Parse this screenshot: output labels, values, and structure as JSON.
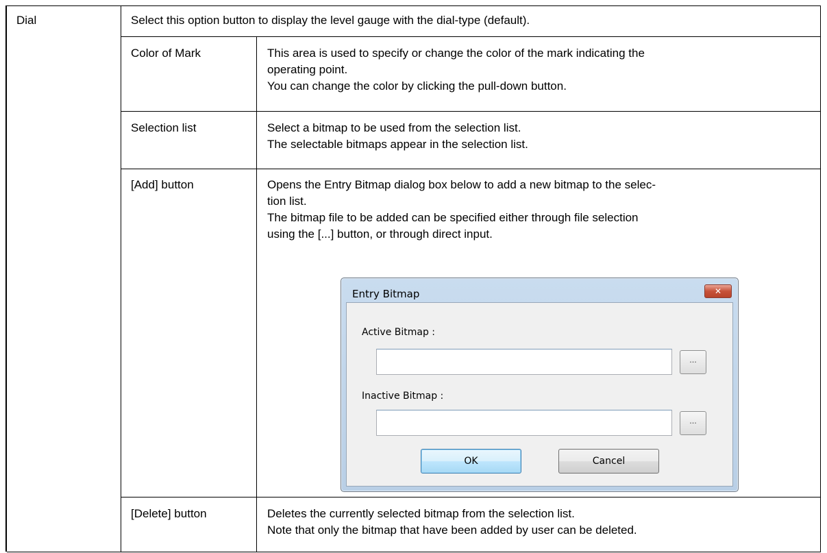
{
  "rows": {
    "dial": {
      "label": "Dial",
      "description": "Select this option button to display the level gauge with the dial-type (default)."
    },
    "color_of_mark": {
      "label": "Color of Mark",
      "lines": [
        "This area is used to specify or change the color of the mark indicating the",
        "operating point.",
        "You can change the color by clicking the pull-down button."
      ]
    },
    "selection_list": {
      "label": "Selection list",
      "lines": [
        "Select a bitmap to be used from the selection list.",
        "The selectable bitmaps appear in the selection list."
      ]
    },
    "add_button": {
      "label": "[Add] button",
      "lines": [
        "Opens the Entry Bitmap dialog box below to add a new bitmap to the selec-",
        "tion list.",
        "The bitmap file to be added can be specified either through file selection",
        "using the [...] button, or through direct input."
      ]
    },
    "delete_button": {
      "label": "[Delete] button",
      "lines": [
        "Deletes the currently selected bitmap from the selection list.",
        "Note that only the bitmap that have been added by user can be deleted."
      ]
    }
  },
  "dialog": {
    "title": "Entry Bitmap",
    "close_glyph": "✕",
    "active_label": "Active Bitmap :",
    "active_value": "",
    "inactive_label": "Inactive Bitmap :",
    "inactive_value": "",
    "browse_label": "...",
    "ok_label": "OK",
    "cancel_label": "Cancel"
  }
}
